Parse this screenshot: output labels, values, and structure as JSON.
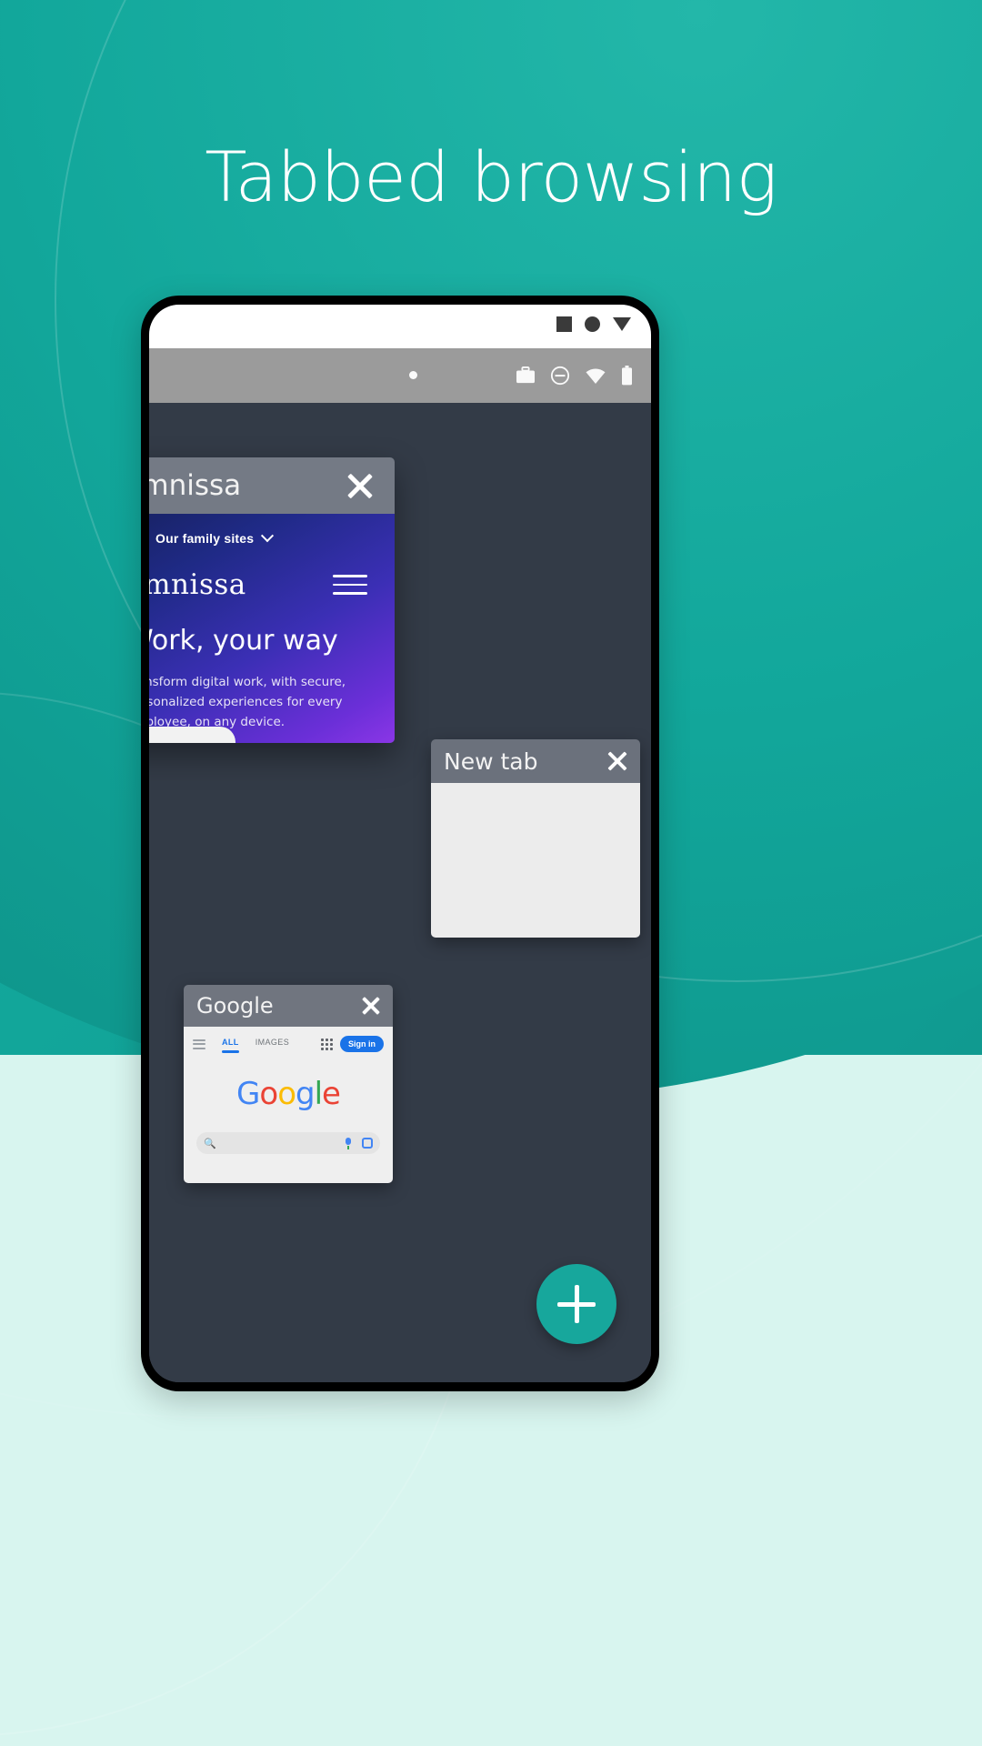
{
  "page": {
    "title": "Tabbed browsing",
    "background_gradient_from": "#13a99c",
    "background_gradient_to": "#0d8f86",
    "bottom_band_color": "#d8f5ef"
  },
  "phone": {
    "status_bar": {
      "icons": [
        "briefcase-icon",
        "do-not-disturb-icon",
        "wifi-icon",
        "battery-icon"
      ],
      "nav_icons": [
        "square-icon",
        "circle-icon",
        "triangle-icon"
      ]
    },
    "tab_switcher": {
      "background_color": "#333b47",
      "header_color": "#6b717c",
      "tabs": [
        {
          "title": "Omnissa",
          "close_label": "close-tab",
          "page": {
            "family_sites_label": "Our family sites",
            "wordmark": "omnissa",
            "wordmark_mark": "™",
            "headline": "Work, your way",
            "paragraph": "Transform digital work, with secure, personalized experiences for every employee, on any device.",
            "gradient_from": "#17215e",
            "gradient_to": "#8a36e6"
          }
        },
        {
          "title": "New tab",
          "close_label": "close-tab",
          "page": {
            "blank_color": "#ececec"
          }
        },
        {
          "title": "Google",
          "close_label": "close-tab",
          "page": {
            "tabs": [
              {
                "label": "ALL",
                "active": true
              },
              {
                "label": "IMAGES",
                "active": false
              }
            ],
            "sign_in_label": "Sign in",
            "logo_letters": [
              {
                "char": "G",
                "color": "#4285f4"
              },
              {
                "char": "o",
                "color": "#ea4335"
              },
              {
                "char": "o",
                "color": "#fbbc05"
              },
              {
                "char": "g",
                "color": "#4285f4"
              },
              {
                "char": "l",
                "color": "#34a853"
              },
              {
                "char": "e",
                "color": "#ea4335"
              }
            ],
            "search_placeholder": "",
            "search_icons": [
              "search-icon",
              "microphone-icon",
              "google-lens-icon"
            ],
            "accent_color": "#1a73e8"
          }
        }
      ],
      "new_tab_button": {
        "label": "+",
        "color": "#17a79c"
      }
    }
  }
}
